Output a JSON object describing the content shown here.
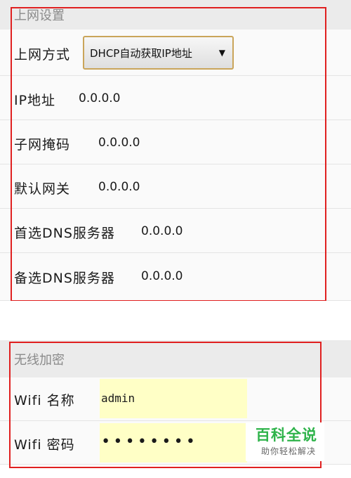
{
  "internet_settings": {
    "header": "上网设置",
    "connection_type": {
      "label": "上网方式",
      "selected": "DHCP自动获取IP地址"
    },
    "ip": {
      "label": "IP地址",
      "value": "0.0.0.0"
    },
    "subnet": {
      "label": "子网掩码",
      "value": "0.0.0.0"
    },
    "gateway": {
      "label": "默认网关",
      "value": "0.0.0.0"
    },
    "dns_primary": {
      "label": "首选DNS服务器",
      "value": "0.0.0.0"
    },
    "dns_secondary": {
      "label": "备选DNS服务器",
      "value": "0.0.0.0"
    }
  },
  "wireless_security": {
    "header": "无线加密",
    "wifi_name": {
      "label": "Wifi 名称",
      "value": "admin"
    },
    "wifi_password": {
      "label": "Wifi 密码",
      "value": "••••••••"
    }
  },
  "watermark": {
    "title": "百科全说",
    "subtitle": "助你轻松解决"
  },
  "colors": {
    "highlight_box": "#e02020",
    "input_bg": "#ffffc6",
    "watermark": "#2eb34a"
  }
}
